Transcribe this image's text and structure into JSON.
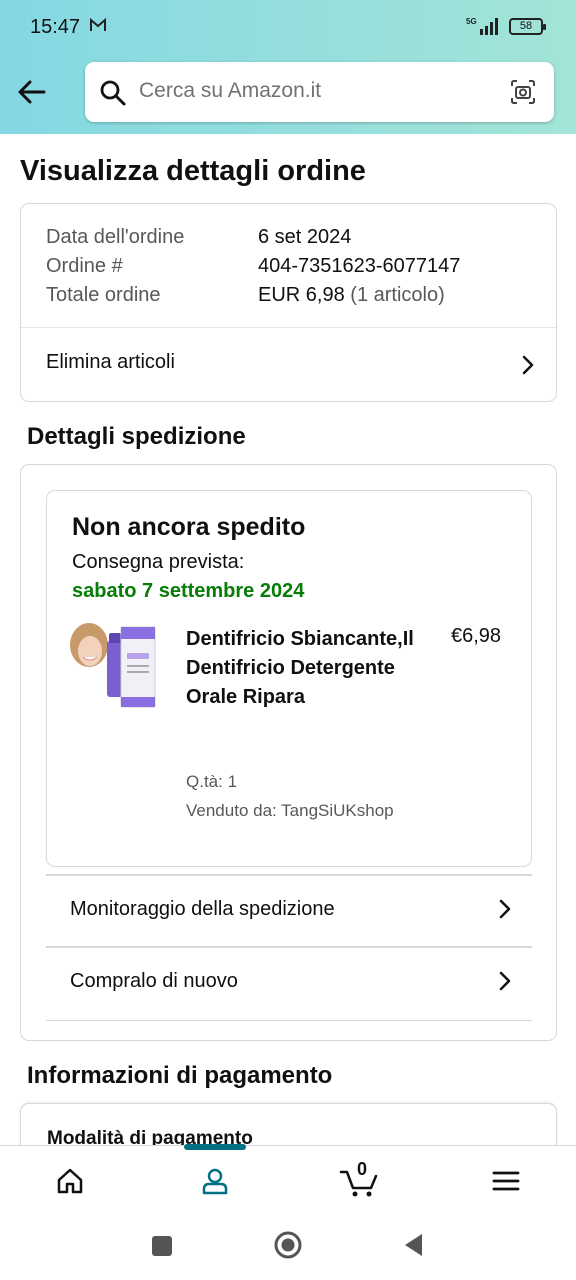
{
  "status_bar": {
    "time": "15:47",
    "battery": "58",
    "network": "5G"
  },
  "search": {
    "placeholder": "Cerca su Amazon.it"
  },
  "page": {
    "title": "Visualizza dettagli ordine"
  },
  "order_summary": {
    "date_label": "Data dell'ordine",
    "date_value": "6 set 2024",
    "number_label": "Ordine #",
    "number_value": "404-7351623-6077147",
    "total_label": "Totale ordine",
    "total_value": "EUR 6,98",
    "total_items": "(1 articolo)",
    "remove_items_label": "Elimina articoli"
  },
  "shipping": {
    "section_title": "Dettagli spedizione",
    "status": "Non ancora spedito",
    "eta_label": "Consegna prevista:",
    "eta_date": "sabato 7 settembre 2024",
    "product": {
      "name": "Dentifricio Sbiancante,Il Dentifricio Detergente Orale Ripara",
      "price": "€6,98",
      "quantity": "Q.tà: 1",
      "seller": "Venduto da: TangSiUKshop"
    },
    "track_label": "Monitoraggio della spedizione",
    "buy_again_label": "Compralo di nuovo"
  },
  "payment": {
    "section_title": "Informazioni di pagamento",
    "method_label": "Modalità di pagamento"
  },
  "bottom_nav": {
    "cart_count": "0"
  },
  "colors": {
    "accent": "#007185",
    "delivery_green": "#067d06",
    "header_start": "#84d8e3",
    "header_end": "#a3e4d7"
  }
}
